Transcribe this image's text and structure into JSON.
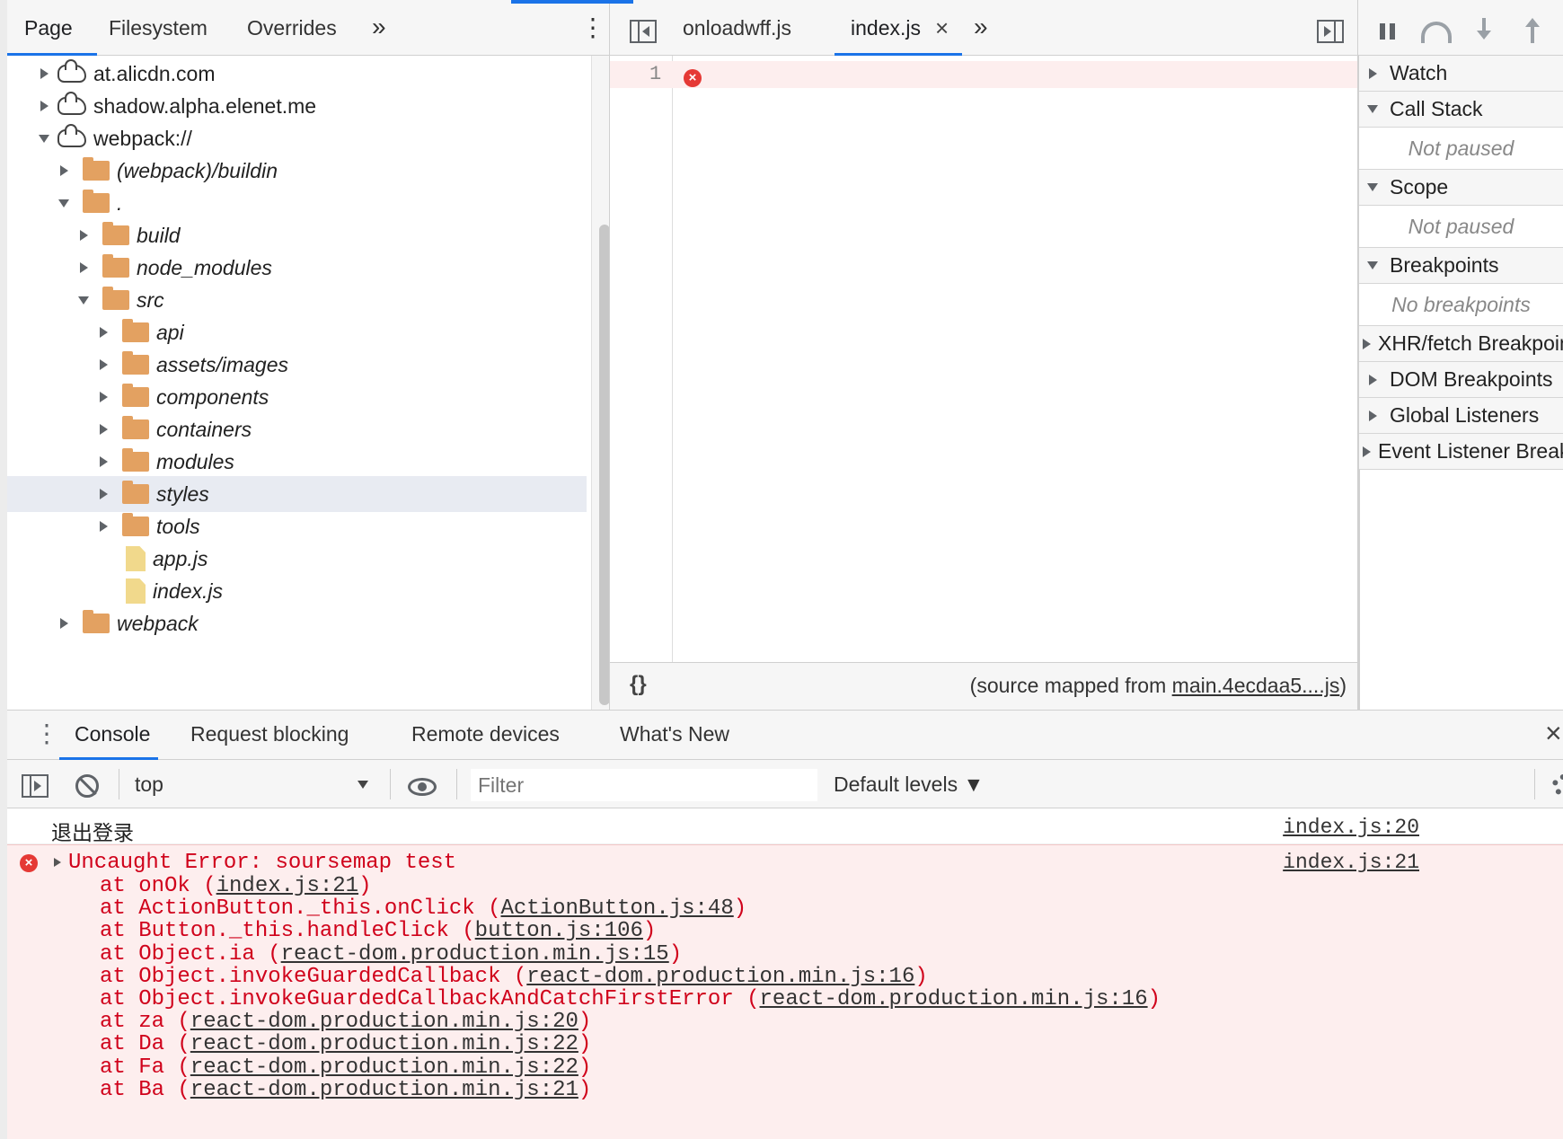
{
  "navigator": {
    "tabs": [
      "Page",
      "Filesystem",
      "Overrides"
    ],
    "more": "»",
    "menu": "⋮",
    "tree": [
      {
        "label": "at.alicdn.com",
        "kind": "origin",
        "expanded": false,
        "italic": false
      },
      {
        "label": "shadow.alpha.elenet.me",
        "kind": "origin",
        "expanded": false,
        "italic": false
      },
      {
        "label": "webpack://",
        "kind": "origin",
        "expanded": true,
        "italic": false
      },
      {
        "label": "(webpack)/buildin",
        "kind": "folder",
        "expanded": false,
        "italic": true
      },
      {
        "label": ".",
        "kind": "folder",
        "expanded": true,
        "italic": true
      },
      {
        "label": "build",
        "kind": "folder",
        "expanded": false,
        "italic": true
      },
      {
        "label": "node_modules",
        "kind": "folder",
        "expanded": false,
        "italic": true
      },
      {
        "label": "src",
        "kind": "folder",
        "expanded": true,
        "italic": true
      },
      {
        "label": "api",
        "kind": "folder",
        "expanded": false,
        "italic": true
      },
      {
        "label": "assets/images",
        "kind": "folder",
        "expanded": false,
        "italic": true
      },
      {
        "label": "components",
        "kind": "folder",
        "expanded": false,
        "italic": true
      },
      {
        "label": "containers",
        "kind": "folder",
        "expanded": false,
        "italic": true
      },
      {
        "label": "modules",
        "kind": "folder",
        "expanded": false,
        "italic": true
      },
      {
        "label": "styles",
        "kind": "folder",
        "expanded": false,
        "italic": true,
        "selected": true
      },
      {
        "label": "tools",
        "kind": "folder",
        "expanded": false,
        "italic": true
      },
      {
        "label": "app.js",
        "kind": "file",
        "italic": true
      },
      {
        "label": "index.js",
        "kind": "file",
        "italic": true
      },
      {
        "label": "webpack",
        "kind": "folder",
        "expanded": false,
        "italic": true
      }
    ]
  },
  "editor": {
    "tabs": [
      {
        "label": "onloadwff.js",
        "active": false
      },
      {
        "label": "index.js",
        "active": true,
        "close": "×"
      }
    ],
    "more": "»",
    "line_number": "1",
    "format_button": "{}",
    "source_mapped_prefix": "(source mapped from ",
    "source_mapped_link": "main.4ecdaa5....js",
    "source_mapped_suffix": ")"
  },
  "debugger": {
    "sections": [
      {
        "label": "Watch",
        "expanded": false
      },
      {
        "label": "Call Stack",
        "expanded": true,
        "content": "Not paused"
      },
      {
        "label": "Scope",
        "expanded": true,
        "content": "Not paused"
      },
      {
        "label": "Breakpoints",
        "expanded": true,
        "content": "No breakpoints"
      },
      {
        "label": "XHR/fetch Breakpoints",
        "expanded": false
      },
      {
        "label": "DOM Breakpoints",
        "expanded": false
      },
      {
        "label": "Global Listeners",
        "expanded": false
      },
      {
        "label": "Event Listener Breakpoints",
        "expanded": false
      }
    ]
  },
  "drawer": {
    "tabs": [
      "Console",
      "Request blocking",
      "Remote devices",
      "What's New"
    ],
    "close": "×",
    "context": "top",
    "filter_placeholder": "Filter",
    "levels": "Default levels ▼"
  },
  "console": {
    "log_text": "退出登录",
    "log_source": "index.js:20",
    "error_source": "index.js:21",
    "error_title": "Uncaught Error: soursemap test",
    "stack": [
      {
        "fn": "at onOk (",
        "link": "index.js:21",
        "end": ")"
      },
      {
        "fn": "at ActionButton._this.onClick (",
        "link": "ActionButton.js:48",
        "end": ")"
      },
      {
        "fn": "at Button._this.handleClick (",
        "link": "button.js:106",
        "end": ")"
      },
      {
        "fn": "at Object.ia (",
        "link": "react-dom.production.min.js:15",
        "end": ")"
      },
      {
        "fn": "at Object.invokeGuardedCallback (",
        "link": "react-dom.production.min.js:16",
        "end": ")"
      },
      {
        "fn": "at Object.invokeGuardedCallbackAndCatchFirstError (",
        "link": "react-dom.production.min.js:16",
        "end": ")"
      },
      {
        "fn": "at za (",
        "link": "react-dom.production.min.js:20",
        "end": ")"
      },
      {
        "fn": "at Da (",
        "link": "react-dom.production.min.js:22",
        "end": ")"
      },
      {
        "fn": "at Fa (",
        "link": "react-dom.production.min.js:22",
        "end": ")"
      },
      {
        "fn": "at Ba (",
        "link": "react-dom.production.min.js:21",
        "end": ")"
      }
    ]
  }
}
